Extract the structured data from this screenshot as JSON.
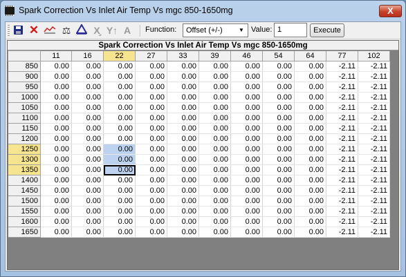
{
  "window": {
    "title": "Spark Correction Vs Inlet Air Temp Vs mgc 850-1650mg",
    "close_label": "X"
  },
  "toolbar": {
    "icons": [
      "save-icon",
      "delete-icon",
      "graph-icon",
      "balance-icon",
      "triangle-icon",
      "cut-icon",
      "up-arrow-icon",
      "letter-a-icon"
    ],
    "function_label": "Function:",
    "function_selected": "Offset (+/-)",
    "value_label": "Value:",
    "value": "1",
    "execute_label": "Execute"
  },
  "table": {
    "title": "Spark Correction Vs Inlet Air Temp Vs mgc 850-1650mg",
    "columns": [
      "11",
      "16",
      "22",
      "27",
      "33",
      "39",
      "46",
      "54",
      "64",
      "77",
      "102"
    ],
    "rows": [
      "850",
      "900",
      "950",
      "1000",
      "1050",
      "1100",
      "1150",
      "1200",
      "1250",
      "1300",
      "1350",
      "1400",
      "1450",
      "1500",
      "1550",
      "1600",
      "1650"
    ],
    "values": [
      [
        "0.00",
        "0.00",
        "0.00",
        "0.00",
        "0.00",
        "0.00",
        "0.00",
        "0.00",
        "0.00",
        "-2.11",
        "-2.11"
      ],
      [
        "0.00",
        "0.00",
        "0.00",
        "0.00",
        "0.00",
        "0.00",
        "0.00",
        "0.00",
        "0.00",
        "-2.11",
        "-2.11"
      ],
      [
        "0.00",
        "0.00",
        "0.00",
        "0.00",
        "0.00",
        "0.00",
        "0.00",
        "0.00",
        "0.00",
        "-2.11",
        "-2.11"
      ],
      [
        "0.00",
        "0.00",
        "0.00",
        "0.00",
        "0.00",
        "0.00",
        "0.00",
        "0.00",
        "0.00",
        "-2.11",
        "-2.11"
      ],
      [
        "0.00",
        "0.00",
        "0.00",
        "0.00",
        "0.00",
        "0.00",
        "0.00",
        "0.00",
        "0.00",
        "-2.11",
        "-2.11"
      ],
      [
        "0.00",
        "0.00",
        "0.00",
        "0.00",
        "0.00",
        "0.00",
        "0.00",
        "0.00",
        "0.00",
        "-2.11",
        "-2.11"
      ],
      [
        "0.00",
        "0.00",
        "0.00",
        "0.00",
        "0.00",
        "0.00",
        "0.00",
        "0.00",
        "0.00",
        "-2.11",
        "-2.11"
      ],
      [
        "0.00",
        "0.00",
        "0.00",
        "0.00",
        "0.00",
        "0.00",
        "0.00",
        "0.00",
        "0.00",
        "-2.11",
        "-2.11"
      ],
      [
        "0.00",
        "0.00",
        "0.00",
        "0.00",
        "0.00",
        "0.00",
        "0.00",
        "0.00",
        "0.00",
        "-2.11",
        "-2.11"
      ],
      [
        "0.00",
        "0.00",
        "0.00",
        "0.00",
        "0.00",
        "0.00",
        "0.00",
        "0.00",
        "0.00",
        "-2.11",
        "-2.11"
      ],
      [
        "0.00",
        "0.00",
        "0.00",
        "0.00",
        "0.00",
        "0.00",
        "0.00",
        "0.00",
        "0.00",
        "-2.11",
        "-2.11"
      ],
      [
        "0.00",
        "0.00",
        "0.00",
        "0.00",
        "0.00",
        "0.00",
        "0.00",
        "0.00",
        "0.00",
        "-2.11",
        "-2.11"
      ],
      [
        "0.00",
        "0.00",
        "0.00",
        "0.00",
        "0.00",
        "0.00",
        "0.00",
        "0.00",
        "0.00",
        "-2.11",
        "-2.11"
      ],
      [
        "0.00",
        "0.00",
        "0.00",
        "0.00",
        "0.00",
        "0.00",
        "0.00",
        "0.00",
        "0.00",
        "-2.11",
        "-2.11"
      ],
      [
        "0.00",
        "0.00",
        "0.00",
        "0.00",
        "0.00",
        "0.00",
        "0.00",
        "0.00",
        "0.00",
        "-2.11",
        "-2.11"
      ],
      [
        "0.00",
        "0.00",
        "0.00",
        "0.00",
        "0.00",
        "0.00",
        "0.00",
        "0.00",
        "0.00",
        "-2.11",
        "-2.11"
      ],
      [
        "0.00",
        "0.00",
        "0.00",
        "0.00",
        "0.00",
        "0.00",
        "0.00",
        "0.00",
        "0.00",
        "-2.11",
        "-2.11"
      ]
    ],
    "highlight_column_index": 2,
    "highlight_rows": [
      "1250",
      "1300",
      "1350"
    ],
    "selected_cells": [
      [
        8,
        2
      ],
      [
        9,
        2
      ],
      [
        10,
        2
      ]
    ],
    "active_cell": [
      10,
      2
    ]
  },
  "colors": {
    "highlight_header": "#f7e48f",
    "selection": "#bdd2ef",
    "grid_background": "#808080"
  }
}
